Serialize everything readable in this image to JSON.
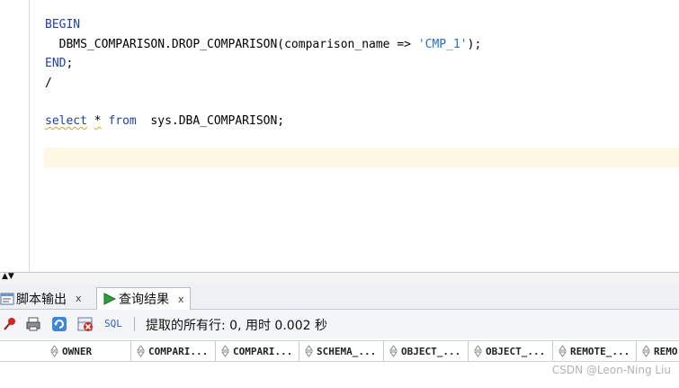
{
  "editor": {
    "lines": [
      {
        "parts": [
          {
            "t": "BEGIN",
            "k": "kw"
          }
        ]
      },
      {
        "parts": [
          {
            "t": "  DBMS_COMPARISON.DROP_COMPARISON(comparison_name => ",
            "k": ""
          },
          {
            "t": "'CMP_1'",
            "k": "str"
          },
          {
            "t": ");",
            "k": ""
          }
        ]
      },
      {
        "parts": [
          {
            "t": "END",
            "k": "kw"
          },
          {
            "t": ";",
            "k": ""
          }
        ]
      },
      {
        "parts": [
          {
            "t": "/",
            "k": ""
          }
        ]
      },
      {
        "parts": []
      },
      {
        "parts": [
          {
            "t": "select",
            "k": "kw squig"
          },
          {
            "t": " ",
            "k": ""
          },
          {
            "t": "*",
            "k": "squig"
          },
          {
            "t": " ",
            "k": ""
          },
          {
            "t": "from",
            "k": "kw"
          },
          {
            "t": "  sys.DBA_COMPARISON;",
            "k": ""
          }
        ]
      }
    ]
  },
  "tabs": {
    "script_output": "脚本输出",
    "query_result": "查询结果",
    "close_symbol": "x"
  },
  "toolbar": {
    "sql_label": "SQL",
    "status_text": "提取的所有行: 0, 用时 0.002 秒"
  },
  "grid": {
    "columns": [
      "OWNER",
      "COMPARI...",
      "COMPARI...",
      "SCHEMA_...",
      "OBJECT_...",
      "OBJECT_...",
      "REMOTE_...",
      "REMO"
    ]
  },
  "watermark": "CSDN @Leon-Ning Liu",
  "colors": {
    "keyword": "#1f3fa8",
    "string": "#1f6fd0",
    "current_line": "#fdf8e4",
    "squiggle": "#d8a800"
  }
}
